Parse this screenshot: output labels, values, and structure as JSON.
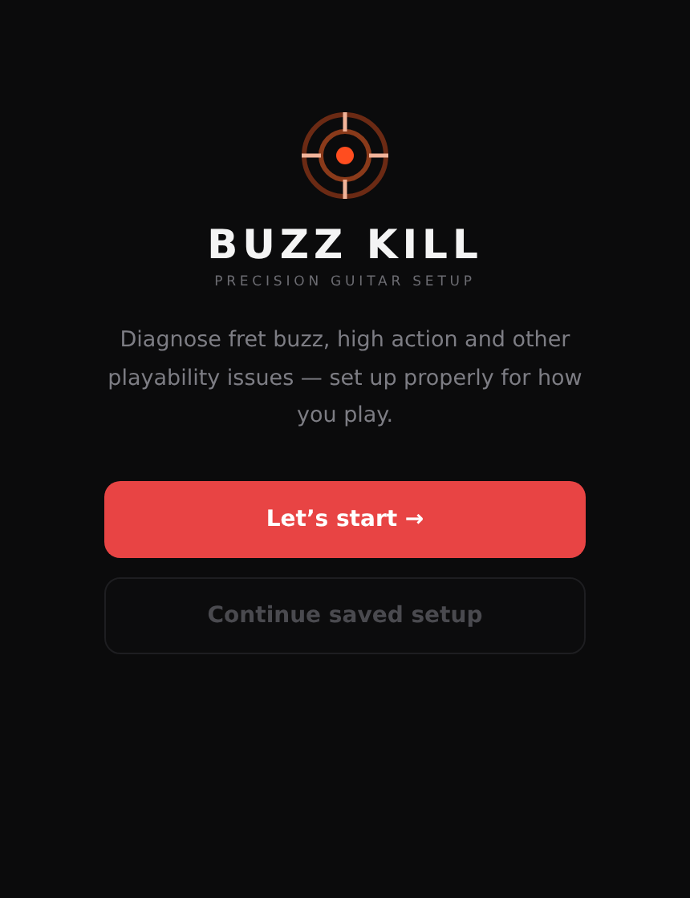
{
  "app": {
    "title": "BUZZ KILL",
    "subtitle": "PRECISION GUITAR SETUP"
  },
  "description": "Diagnose fret buzz, high action and other playability issues — set up properly for how you play.",
  "buttons": [
    {
      "label": "Let’s start →",
      "kind": "primary",
      "disabled": false
    },
    {
      "label": "Continue saved setup",
      "kind": "secondary",
      "disabled": true
    }
  ]
}
